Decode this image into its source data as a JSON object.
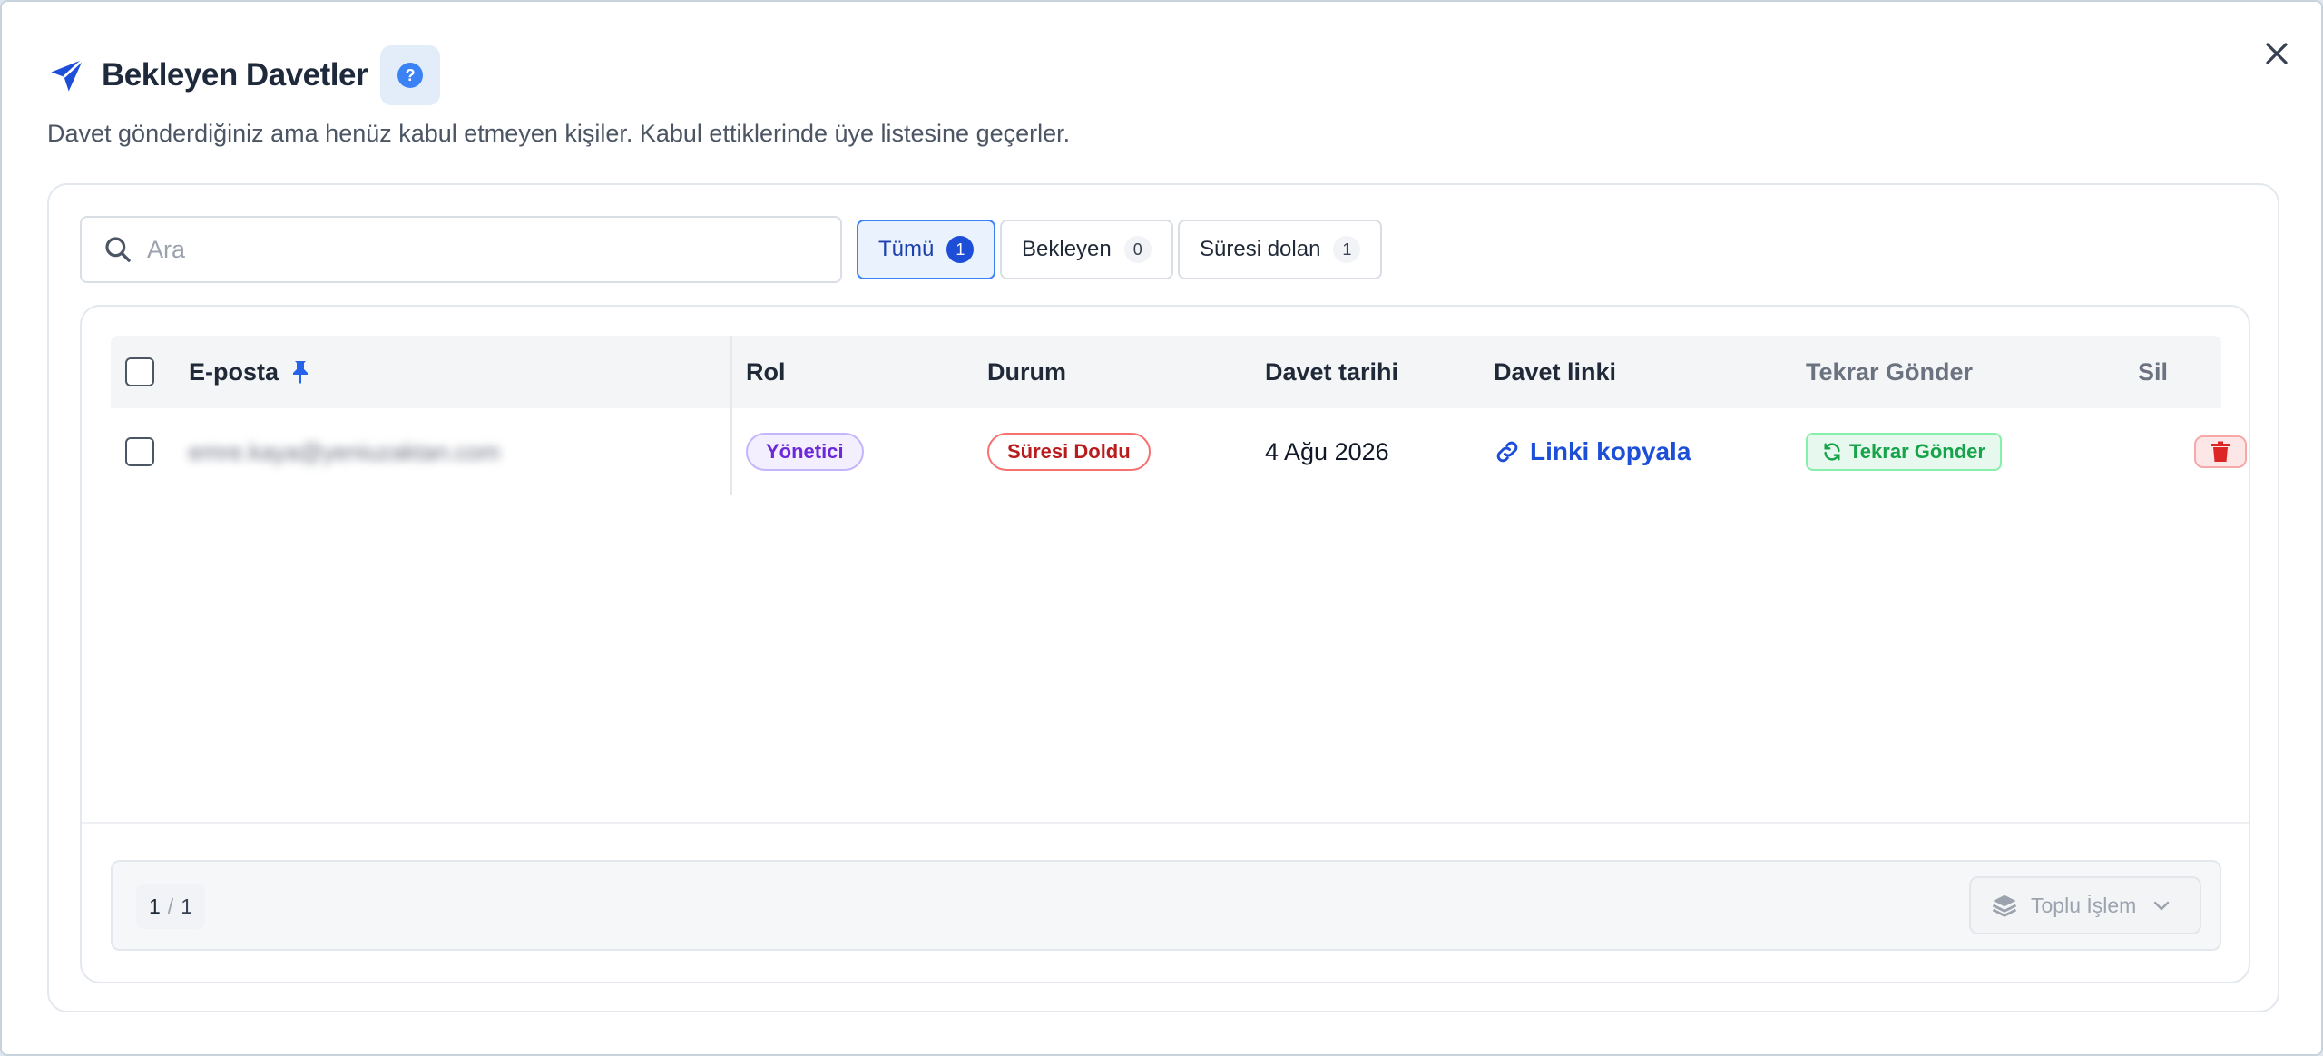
{
  "header": {
    "title": "Bekleyen Davetler",
    "help_label": "?",
    "subtitle": "Davet gönderdiğiniz ama henüz kabul etmeyen kişiler. Kabul ettiklerinde üye listesine geçerler."
  },
  "search": {
    "placeholder": "Ara",
    "value": ""
  },
  "filters": [
    {
      "label": "Tümü",
      "count": "1",
      "active": true
    },
    {
      "label": "Bekleyen",
      "count": "0",
      "active": false
    },
    {
      "label": "Süresi dolan",
      "count": "1",
      "active": false
    }
  ],
  "table": {
    "columns": {
      "email": "E-posta",
      "role": "Rol",
      "status": "Durum",
      "invite_date": "Davet tarihi",
      "invite_link": "Davet linki",
      "resend": "Tekrar Gönder",
      "delete": "Sil"
    },
    "rows": [
      {
        "email": "emre.kaya@yeniuzaktan.com",
        "role": "Yönetici",
        "status": "Süresi Doldu",
        "invite_date": "4 Ağu 2026",
        "link_label": "Linki kopyala",
        "resend_label": "Tekrar Gönder"
      }
    ]
  },
  "footer": {
    "page_current": "1",
    "page_separator": "/",
    "page_total": "1",
    "bulk_label": "Toplu İşlem"
  },
  "colors": {
    "accent": "#1d4ed8",
    "role_badge": "#6d28d9",
    "expired": "#b91c1c",
    "resend": "#16a34a",
    "delete": "#dc2626"
  }
}
